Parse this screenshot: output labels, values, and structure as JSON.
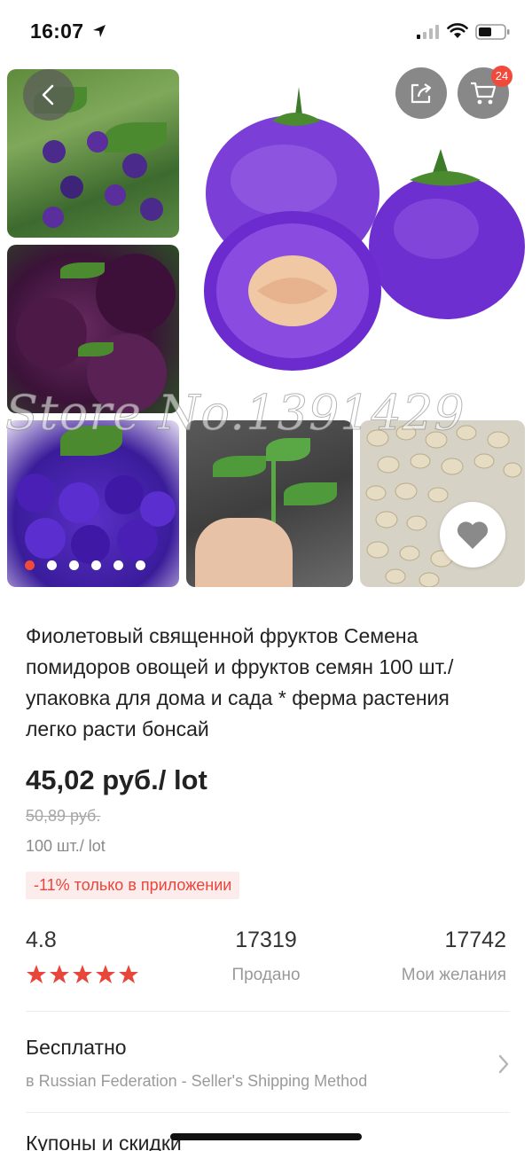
{
  "status_bar": {
    "time": "16:07"
  },
  "gallery": {
    "watermark": "Store No.1391429",
    "cart_count": "24",
    "dots_total": 6,
    "dots_active": 0
  },
  "product": {
    "title": "Фиолетовый священной фруктов Семена помидоров овощей и фруктов семян 100 шт./упаковка для дома и сада * ферма растения легко расти бонсай",
    "price": "45,02 руб./ lot",
    "old_price": "50,89 руб.",
    "pack": "100 шт./ lot",
    "promo": "-11% только в приложении"
  },
  "stats": {
    "rating": "4.8",
    "rating_stars": 5,
    "sold_value": "17319",
    "sold_label": "Продано",
    "wish_value": "17742",
    "wish_label": "Мои желания"
  },
  "shipping": {
    "title": "Бесплатно",
    "subtitle": "в Russian Federation - Seller's Shipping Method"
  },
  "coupons": {
    "title": "Купоны и скидки"
  },
  "colors": {
    "accent": "#f04a3a",
    "star": "#e8463a",
    "promo_bg": "#fdecec"
  },
  "icons": [
    "location-arrow-icon",
    "signal-icon",
    "wifi-icon",
    "battery-icon",
    "back-icon",
    "share-icon",
    "cart-icon",
    "heart-icon",
    "star-icon",
    "chevron-right-icon"
  ]
}
